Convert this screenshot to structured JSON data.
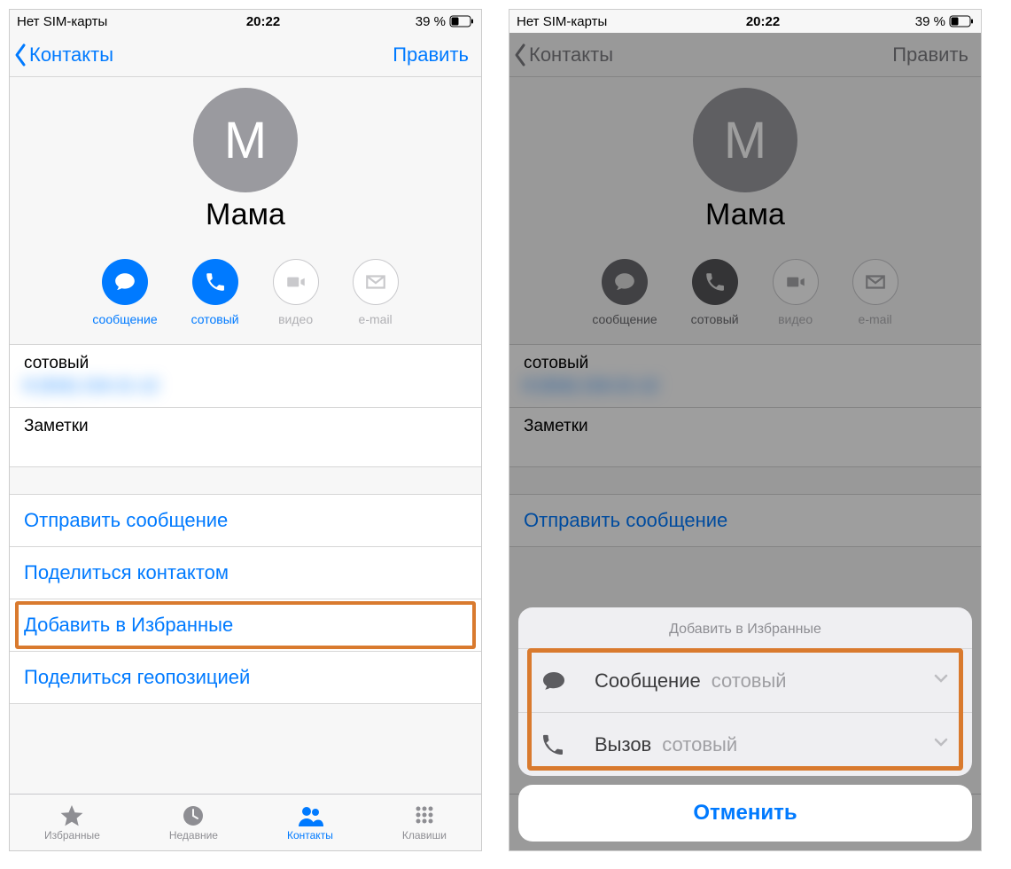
{
  "status": {
    "carrier": "Нет SIM-карты",
    "time": "20:22",
    "battery_pct": "39 %"
  },
  "nav": {
    "back_label": "Контакты",
    "edit_label": "Править"
  },
  "contact": {
    "avatar_initial": "М",
    "name": "Мама",
    "actions": {
      "message": "сообщение",
      "call": "сотовый",
      "video": "видео",
      "email": "e-mail"
    },
    "phone_label": "сотовый",
    "notes_label": "Заметки"
  },
  "actions_list": {
    "send_message": "Отправить сообщение",
    "share_contact": "Поделиться контактом",
    "add_favorites": "Добавить в Избранные",
    "share_location": "Поделиться геопозицией"
  },
  "tabs": {
    "favorites": "Избранные",
    "recents": "Недавние",
    "contacts": "Контакты",
    "keypad": "Клавиши"
  },
  "sheet": {
    "title": "Добавить в Избранные",
    "rows": [
      {
        "main": "Сообщение",
        "sub": "сотовый"
      },
      {
        "main": "Вызов",
        "sub": "сотовый"
      }
    ],
    "cancel": "Отменить"
  },
  "colors": {
    "accent": "#007aff",
    "highlight": "#d97a2e"
  }
}
